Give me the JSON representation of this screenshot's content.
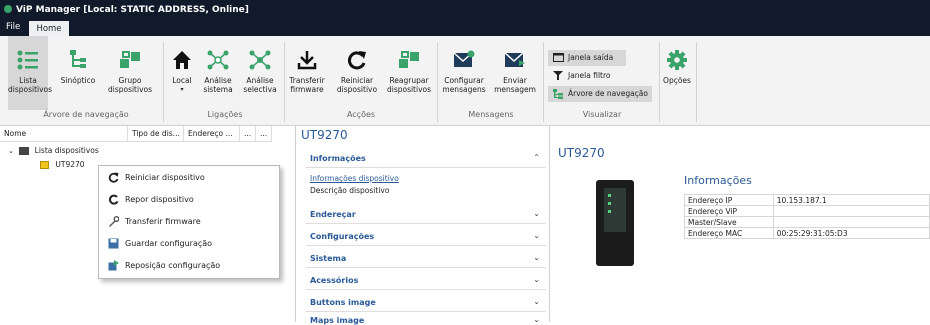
{
  "window": {
    "title": "ViP Manager [Local: STATIC ADDRESS, Online]"
  },
  "menu": {
    "file": "File",
    "home": "Home"
  },
  "ribbon": {
    "groups": {
      "arvore": "Árvore de navegação",
      "ligacoes": "Ligações",
      "accoes": "Acções",
      "mensagens": "Mensagens",
      "visualizar": "Visualizar"
    },
    "buttons": {
      "lista_1": "Lista",
      "lista_2": "dispositivos",
      "sinoptico": "Sinóptico",
      "grupo_1": "Grupo",
      "grupo_2": "dispositivos",
      "local": "Local",
      "analise_sistema_1": "Análise",
      "analise_sistema_2": "sistema",
      "analise_selectiva_1": "Análise",
      "analise_selectiva_2": "selectiva",
      "transferir_1": "Transferir",
      "transferir_2": "firmware",
      "reiniciar_1": "Reiniciar",
      "reiniciar_2": "dispositivo",
      "reagrupar_1": "Reagrupar",
      "reagrupar_2": "dispositivos",
      "configurar_1": "Configurar",
      "configurar_2": "mensagens",
      "enviar_1": "Enviar",
      "enviar_2": "mensagem",
      "opcoes": "Opções"
    },
    "visualizar_items": {
      "janela_saida": "Janela saída",
      "janela_filtro": "Janela filtro",
      "arvore_navegacao": "Árvore de navegação"
    }
  },
  "tree": {
    "columns": {
      "nome": "Nome",
      "tipo": "Tipo de dis...",
      "endereco": "Endereço ...",
      "col4": "...",
      "col5": "..."
    },
    "root": "Lista dispositivos",
    "device": "UT9270"
  },
  "context_menu": {
    "items": [
      "Reiniciar dispositivo",
      "Repor dispositivo",
      "Transferir firmware",
      "Guardar configuração",
      "Reposição configuração"
    ]
  },
  "middle": {
    "title": "UT9270",
    "sections": [
      "Informações",
      "Endereçar",
      "Configurações",
      "Sistema",
      "Acessórios",
      "Buttons image",
      "Maps image"
    ],
    "sub_items": [
      "Informações dispositivo",
      "Descrição dispositivo"
    ]
  },
  "right": {
    "title": "UT9270",
    "info_title": "Informações",
    "rows": [
      {
        "label": "Endereço IP",
        "value": "10.153.187.1"
      },
      {
        "label": "Endereço ViP",
        "value": ""
      },
      {
        "label": "Master/Slave",
        "value": ""
      },
      {
        "label": "Endereço MAC",
        "value": "00:25:29:31:05:D3"
      }
    ]
  },
  "colors": {
    "titlebar": "#101a2a",
    "accent_green": "#3aa36a",
    "link_blue": "#2a5a98"
  }
}
